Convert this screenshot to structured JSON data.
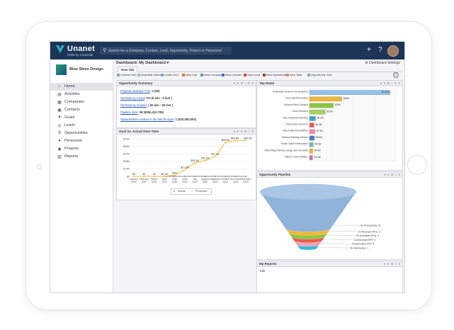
{
  "app": {
    "brand_name": "Unanet",
    "brand_sub": "CRM by Cosential",
    "search_placeholder": "Search for a Company, Contact, Lead, Opportunity, Project or Personnel",
    "top_icons": [
      "plus-icon",
      "help-icon",
      "user-avatar"
    ],
    "top_plus": "+",
    "top_help": "?"
  },
  "sidebar": {
    "company_name": "Blue Skies Design",
    "items": [
      {
        "label": "Home",
        "icon": "home-icon",
        "glyph": "⌂",
        "active": true
      },
      {
        "label": "Activities",
        "icon": "activities-icon",
        "glyph": "▤",
        "active": false
      },
      {
        "label": "Companies",
        "icon": "companies-icon",
        "glyph": "▦",
        "active": false
      },
      {
        "label": "Contacts",
        "icon": "contacts-icon",
        "glyph": "▣",
        "active": false
      },
      {
        "label": "Goals",
        "icon": "goals-icon",
        "glyph": "▼",
        "active": false
      },
      {
        "label": "Leads",
        "icon": "leads-icon",
        "glyph": "◎",
        "active": false
      },
      {
        "label": "Opportunities",
        "icon": "opportunities-icon",
        "glyph": "$",
        "active": false
      },
      {
        "label": "Personnel",
        "icon": "personnel-icon",
        "glyph": "●",
        "active": false
      },
      {
        "label": "Projects",
        "icon": "projects-icon",
        "glyph": "◆",
        "active": false
      },
      {
        "label": "Reports",
        "icon": "reports-icon",
        "glyph": "▥",
        "active": false
      }
    ]
  },
  "dashboard": {
    "title": "Dashboard: My Dashboard ▾",
    "settings_label": "Dashboard Settings",
    "tab_label": "New Tab",
    "toolbar": [
      {
        "label": "Contact Grid",
        "color": "#7aa7d6"
      },
      {
        "label": "Essential Videos",
        "color": "#9ab7d9"
      },
      {
        "label": "Leads Grid",
        "color": "#7aa7d6"
      },
      {
        "label": "New Call",
        "color": "#e07a2c"
      },
      {
        "label": "New Company",
        "color": "#5f8fc9"
      },
      {
        "label": "New Contact",
        "color": "#3c6fb5"
      },
      {
        "label": "New Lead",
        "color": "#c74a3c"
      },
      {
        "label": "New Opportunity",
        "color": "#8b4a2c"
      },
      {
        "label": "New Task",
        "color": "#d68b6a"
      },
      {
        "label": "Opportunity Grid",
        "color": "#7aa7d6"
      }
    ]
  },
  "widgets": {
    "opportunity_summary": {
      "title": "Opportunity Summary",
      "controls": "▾ ✕ ⚙ □ ⟳ ✕",
      "lines": [
        {
          "link": "Projects Awarded YTD",
          "value": ": 0 ($0)"
        },
        {
          "link": "Hit Ratio by Count",
          "value": ": 0% (0 win : 0 lost )"
        },
        {
          "link": "Hit Ratio by Volume",
          "value": ": ( $0 win : $0 lost )"
        },
        {
          "link": "Pipeline Size",
          "value": ": 38 ($250,422,795)"
        },
        {
          "link": "Opportunities created in the last 90 days",
          "value": ": 1 ($10,000,000)"
        }
      ]
    },
    "goal_vs_actual": {
      "title": "Goal Vs. Actual Over Time",
      "controls": "▾ ⟲ ✕ ⚙ □ ✕"
    },
    "top_deals": {
      "title": "Top Deals",
      "controls": "▾ ✕ ⚙ □ ⟳ ✕"
    },
    "opportunity_pipeline": {
      "title": "Opportunity Pipeline",
      "controls": "▾ ✕ ⚙ □ ✕"
    },
    "my_reports": {
      "title": "My Reports",
      "controls": "▾ ✕ ⚙ □ ✕",
      "edit_link": "Edit"
    }
  },
  "chart_data": [
    {
      "type": "line",
      "chart_id": "goal-vs-actual",
      "title": "Goal Vs. Actual Over Time",
      "categories": [
        "January 2020",
        "February 2020",
        "March 2020",
        "April 2020",
        "May 2020",
        "June 2020",
        "July 2020",
        "August 2020",
        "September 2020",
        "October 2020",
        "November 2020",
        "December 2020"
      ],
      "yticks": [
        "$70M",
        "$56M",
        "$42M",
        "$28M",
        "$14M",
        "$0"
      ],
      "ylim": [
        0,
        70
      ],
      "series": [
        {
          "name": "Actual",
          "color": "#666666",
          "values": [
            0,
            0,
            0,
            0,
            0,
            0,
            0,
            0,
            0,
            0,
            0,
            0
          ],
          "labels": [
            "$0",
            "$0",
            "$0",
            "$0",
            "$0",
            "$0",
            "$0",
            "$0",
            "$0",
            "$0",
            "$0",
            "$0"
          ]
        },
        {
          "name": "Projected",
          "color": "#f2b731",
          "values": [
            0,
            0,
            0,
            0.1,
            2,
            12.3,
            25.1,
            29.7,
            37.1,
            63.6,
            66.5,
            66.5
          ],
          "labels": [
            "$0",
            "$0",
            "$0",
            "$0.1M",
            "$2M",
            "$12.3M",
            "$25.1M",
            "$29.7M",
            "$37.1M",
            "$63.6M",
            "$66.5M",
            "$66.5M"
          ]
        }
      ]
    },
    {
      "type": "bar",
      "chart_id": "top-deals",
      "title": "Top Deals",
      "orientation": "horizontal",
      "categories": [
        "Rockefeller Museum Development",
        "Town Hall Restoration",
        "Moscow West Campus",
        "Grand Museum",
        "New Downtown Building",
        "Elementary School III",
        "New Auditorium Addition",
        "Window Building Interiors",
        "Studio Station Renovation",
        "West Wing Parking Garage with Shoreline",
        "Nabors Tower Addition"
      ],
      "values": [
        112,
        45,
        33,
        22,
        8.3,
        6.3,
        7.5,
        6.8,
        5.3,
        4.5,
        4.3
      ],
      "labels": [
        "$112M",
        "$45M",
        "$33M",
        "$22M",
        "$8.3M",
        "$6.3M",
        "$7.5M",
        "$6.8M",
        "$5.3M",
        "$4.5M",
        "$4.3M"
      ],
      "colors": [
        "#8fc3ee",
        "#f2b731",
        "#8cc63f",
        "#a6d45a",
        "#37a8c2",
        "#e85c4a",
        "#f08aa8",
        "#4a78c9",
        "#7fb8a6",
        "#f2b731",
        "#d46bb0"
      ],
      "xlim": [
        0,
        120
      ]
    },
    {
      "type": "funnel",
      "chart_id": "opportunity-pipeline",
      "title": "Opportunity Pipeline",
      "stages": [
        {
          "label": "01-Prospecting, 20",
          "value": 20,
          "color": "#8fb3d9"
        },
        {
          "label": "02-Received RFQ, 3",
          "value": 3,
          "color": "#f2b731"
        },
        {
          "label": "03-Submitted RFQ, 4",
          "value": 4,
          "color": "#8cc63f"
        },
        {
          "label": "04-Received RFP, 4",
          "value": 4,
          "color": "#e85c4a"
        },
        {
          "label": "05-Submitted RFP, 4",
          "value": 4,
          "color": "#f0a0b8"
        },
        {
          "label": "06-Interviewed, 1",
          "value": 1,
          "color": "#3cb8d6"
        }
      ]
    }
  ]
}
